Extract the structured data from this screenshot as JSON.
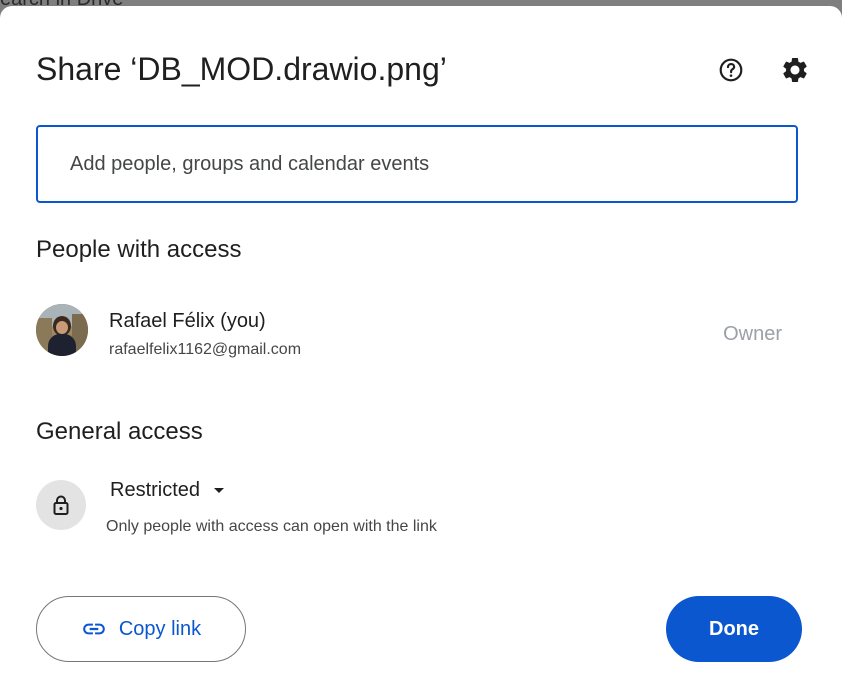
{
  "backdrop": {
    "text": "earch in Drive"
  },
  "dialog": {
    "title": "Share ‘DB_MOD.drawio.png’",
    "help_icon": "help-circle-icon",
    "settings_icon": "gear-icon"
  },
  "add_people": {
    "placeholder": "Add people, groups and calendar events",
    "value": ""
  },
  "people_section": {
    "title": "People with access",
    "people": [
      {
        "name": "Rafael Félix (you)",
        "email": "rafaelfelix1162@gmail.com",
        "role": "Owner",
        "avatar_icon": "profile-photo"
      }
    ]
  },
  "general_access": {
    "title": "General access",
    "icon": "lock-icon",
    "selected": "Restricted",
    "description": "Only people with access can open with the link"
  },
  "footer": {
    "copy_link_label": "Copy link",
    "copy_link_icon": "link-icon",
    "done_label": "Done"
  },
  "colors": {
    "accent": "#0b57d0",
    "text": "#1f1f1f",
    "secondary_text": "#444746",
    "muted_role": "#9aa0a6",
    "lock_circle_bg": "#e3e3e3",
    "backdrop": "#7f7f7f"
  }
}
